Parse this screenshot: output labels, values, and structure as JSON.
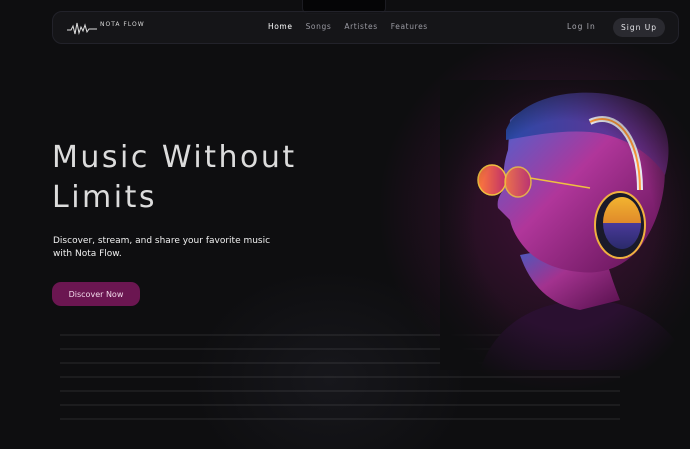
{
  "brand": {
    "name": "NOTA FLOW",
    "logo_icon": "soundwave-icon"
  },
  "nav": {
    "links": [
      {
        "label": "Home",
        "active": true
      },
      {
        "label": "Songs",
        "active": false
      },
      {
        "label": "Artistes",
        "active": false
      },
      {
        "label": "Features",
        "active": false
      }
    ],
    "login_label": "Log In",
    "signup_label": "Sign Up"
  },
  "hero": {
    "title_line1": "Music Without",
    "title_line2": "Limits",
    "subtitle_line1": "Discover, stream, and share your favorite music",
    "subtitle_line2": "with Nota Flow.",
    "cta_label": "Discover Now"
  },
  "colors": {
    "background": "#0e0e10",
    "accent": "#6b1651",
    "glow": "#6e145a"
  }
}
